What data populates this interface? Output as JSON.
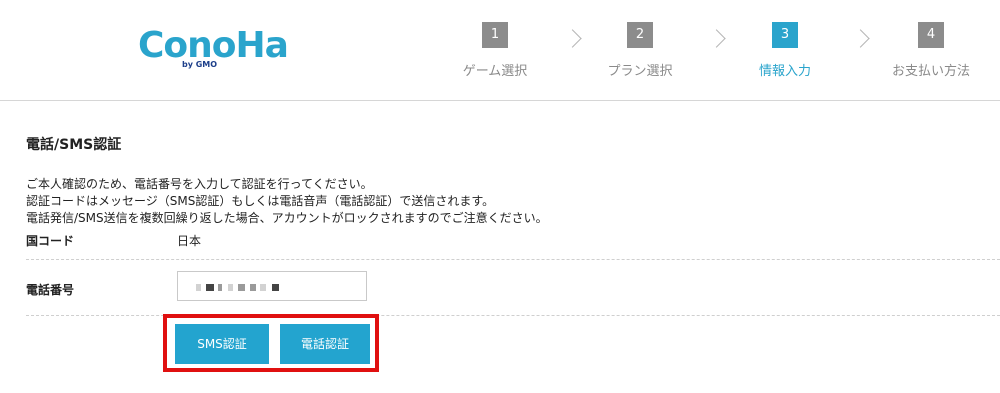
{
  "logo": {
    "name": "ConoHa",
    "sub": "by GMO"
  },
  "steps": [
    {
      "num": "1",
      "label": "ゲーム選択",
      "active": false
    },
    {
      "num": "2",
      "label": "プラン選択",
      "active": false
    },
    {
      "num": "3",
      "label": "情報入力",
      "active": true
    },
    {
      "num": "4",
      "label": "お支払い方法",
      "active": false
    }
  ],
  "section": {
    "title": "電話/SMS認証",
    "description": [
      "ご本人確認のため、電話番号を入力して認証を行ってください。",
      "認証コードはメッセージ（SMS認証）もしくは電話音声（電話認証）で送信されます。",
      "電話発信/SMS送信を複数回繰り返した場合、アカウントがロックされますのでご注意ください。"
    ]
  },
  "country": {
    "label": "国コード",
    "value": "日本"
  },
  "phone": {
    "label": "電話番号",
    "value": ""
  },
  "buttons": {
    "sms": "SMS認証",
    "tel": "電話認証"
  },
  "colors": {
    "accent": "#23a4cf",
    "highlight": "#e01010",
    "inactive_step": "#8c8c8c"
  }
}
